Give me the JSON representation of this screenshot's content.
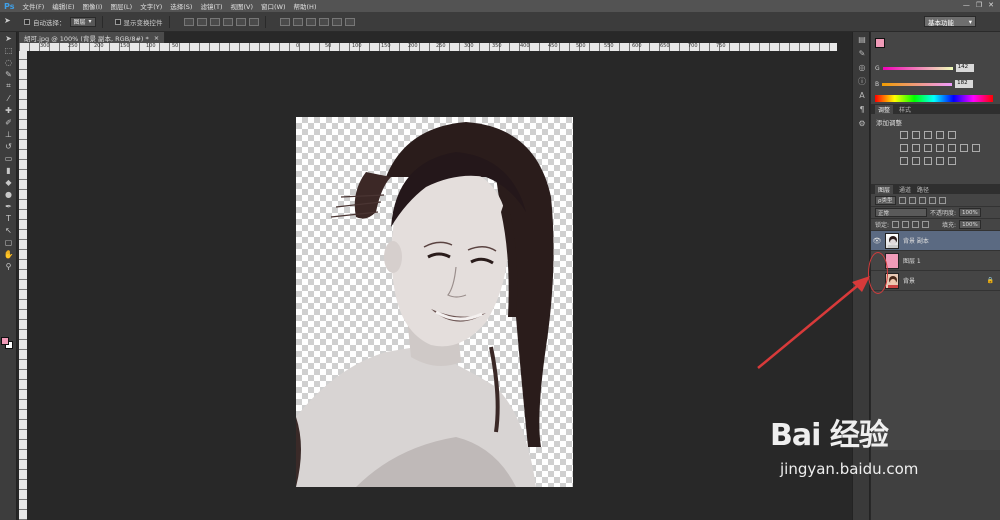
{
  "app": {
    "logo": "Ps"
  },
  "menu": [
    "文件(F)",
    "编辑(E)",
    "图像(I)",
    "图层(L)",
    "文字(Y)",
    "选择(S)",
    "滤镜(T)",
    "视图(V)",
    "窗口(W)",
    "帮助(H)"
  ],
  "window_controls": {
    "minimize": "—",
    "restore": "❐",
    "close": "✕"
  },
  "options": {
    "auto_select_label": "自动选择：",
    "auto_select_value": "图层",
    "transform_label": "显示变换控件",
    "workspace": "基本功能"
  },
  "document": {
    "tab_title": "胡可.jpg @ 100% (背景 副本, RGB/8#) *",
    "tab_close": "×",
    "ruler_marks": [
      "300",
      "250",
      "200",
      "150",
      "100",
      "50",
      "0",
      "50",
      "100",
      "150",
      "200",
      "250",
      "300",
      "350",
      "400",
      "450",
      "500",
      "550",
      "600",
      "650",
      "700",
      "750"
    ]
  },
  "color_panel": {
    "g_label": "G",
    "b_label": "B",
    "g_value": "142",
    "b_value": "182",
    "foreground": "#f09bb8"
  },
  "adjustments": {
    "tabs": [
      "调整",
      "样式"
    ],
    "title": "添加调整"
  },
  "layers": {
    "tabs": [
      "图层",
      "通道",
      "路径"
    ],
    "filter_type": "ρ类型",
    "blend_mode": "正常",
    "opacity_label": "不透明度:",
    "opacity_value": "100%",
    "lock_label": "锁定:",
    "fill_label": "填充:",
    "fill_value": "100%",
    "items": [
      {
        "name": "背景 副本",
        "visible": true,
        "selected": true
      },
      {
        "name": "图层 1",
        "visible": false,
        "selected": false
      },
      {
        "name": "背景",
        "visible": false,
        "selected": false,
        "locked": true
      }
    ]
  },
  "watermark": {
    "brand": "Bai 经验",
    "url": "jingyan.baidu.com"
  }
}
